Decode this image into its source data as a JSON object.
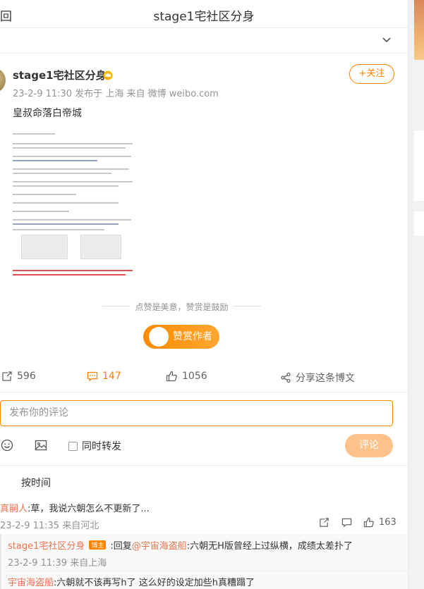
{
  "header": {
    "back_label": "回",
    "title": "stage1宅社区分身"
  },
  "post": {
    "author": "stage1宅社区分身",
    "meta": "23-2-9 11:30  发布于 上海  来自 微博 weibo.com",
    "follow_label": "+关注",
    "text": "皇叔命落白帝城",
    "reward_line": "点赞是美意，赞赏是鼓励",
    "reward_label": "赞赏作者"
  },
  "actions": {
    "repost": "596",
    "comment": "147",
    "like": "1056",
    "share": "分享这条博文"
  },
  "comment_box": {
    "placeholder": "发布你的评论",
    "repost_label": "同时转发",
    "submit_label": "评论"
  },
  "sort_label": "按时间",
  "comments": [
    {
      "user": "真嗣人",
      "text": ":草，我说六朝怎么不更新了...",
      "meta": "23-2-9 11:35 来自河北",
      "likes": "163"
    }
  ],
  "replies": [
    {
      "user": "stage1宅社区分身",
      "badge": "博主",
      "text": ":回复",
      "mention": "@宇宙海盗船",
      "text2": ":六朝无H版曾经上过纵横，成绩太差扑了",
      "meta": "23-2-9 11:39 来自上海"
    },
    {
      "user": "宇宙海盗船",
      "text": ":六朝就不该再写h了 这么好的设定加些h真糟蹋了"
    }
  ],
  "colors": {
    "accent": "#ff8200",
    "link": "#eb7350"
  }
}
